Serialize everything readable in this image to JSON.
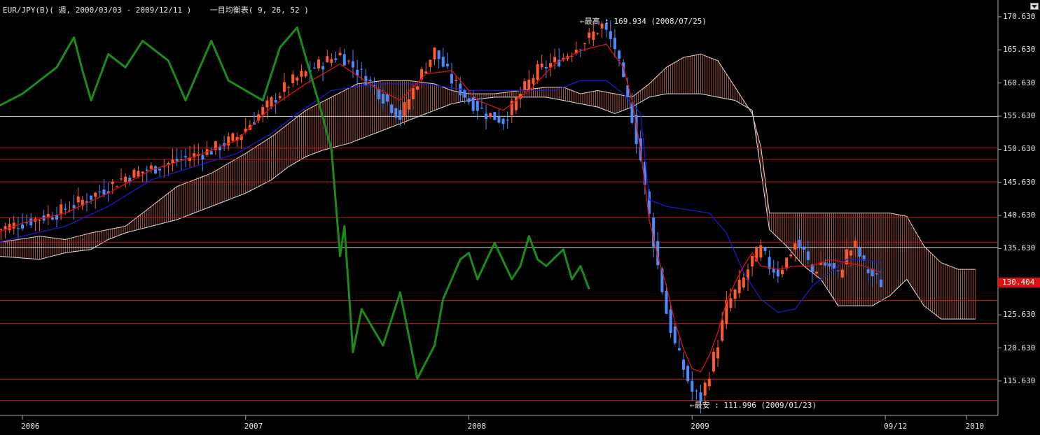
{
  "header": {
    "symbol": "EUR/JPY(B)",
    "period": "週",
    "range": "2000/03/03 - 2009/12/11",
    "indicator": "一目均衡表( 9, 26, 52 )",
    "full": "EUR/JPY(B)( 週, 2000/03/03 - 2009/12/11 )    一目均衡表( 9, 26, 52 )"
  },
  "annotations": {
    "high": "←最高 : 169.934 (2008/07/25)",
    "low": "←最安 : 111.996 (2009/01/23)"
  },
  "current_price": "130.404",
  "colors": {
    "background": "#000000",
    "bull_candle": "#ff5a2a",
    "bear_candle": "#4a8cff",
    "tenkan": "#e01010",
    "kijun": "#1a1ad0",
    "chikou": "#1a8c1a",
    "cloud_bull": "#e07050",
    "cloud_bear": "#7070e0",
    "hline_red": "#d01818",
    "hline_white": "#d8d8d8"
  },
  "chart_data": {
    "type": "candlestick-ichimoku",
    "y_axis": {
      "ticks": [
        "170.630",
        "165.630",
        "160.630",
        "155.630",
        "150.630",
        "145.630",
        "140.630",
        "135.630",
        "130.630",
        "125.630",
        "120.630",
        "115.630"
      ],
      "ylim": [
        111,
        171
      ]
    },
    "x_axis": {
      "ticks": [
        "2006",
        "2007",
        "2008",
        "2009",
        "09/12",
        "2010"
      ],
      "tick_weeks": [
        0,
        52,
        104,
        156,
        201,
        220
      ]
    },
    "horizontal_lines": [
      {
        "value": 155.6,
        "color": "white"
      },
      {
        "value": 150.8,
        "color": "red"
      },
      {
        "value": 149.1,
        "color": "red"
      },
      {
        "value": 145.7,
        "color": "red"
      },
      {
        "value": 140.3,
        "color": "red"
      },
      {
        "value": 136.6,
        "color": "red"
      },
      {
        "value": 135.8,
        "color": "white"
      },
      {
        "value": 127.8,
        "color": "red"
      },
      {
        "value": 124.3,
        "color": "red"
      },
      {
        "value": 115.9,
        "color": "red"
      },
      {
        "value": 112.7,
        "color": "red"
      }
    ],
    "close_keypoints": [
      [
        -6,
        138.5
      ],
      [
        0,
        139.5
      ],
      [
        8,
        141.0
      ],
      [
        16,
        143.5
      ],
      [
        24,
        146.5
      ],
      [
        34,
        148.5
      ],
      [
        44,
        150.5
      ],
      [
        50,
        152.5
      ],
      [
        56,
        156.5
      ],
      [
        62,
        160.5
      ],
      [
        68,
        163.0
      ],
      [
        74,
        165.0
      ],
      [
        82,
        160.0
      ],
      [
        88,
        155.5
      ],
      [
        92,
        161.0
      ],
      [
        96,
        165.5
      ],
      [
        100,
        161.0
      ],
      [
        104,
        158.0
      ],
      [
        108,
        156.0
      ],
      [
        112,
        155.0
      ],
      [
        116,
        159.0
      ],
      [
        120,
        162.5
      ],
      [
        126,
        164.5
      ],
      [
        132,
        167.5
      ],
      [
        135,
        169.3
      ],
      [
        138,
        166.0
      ],
      [
        140,
        160.5
      ],
      [
        142,
        155.5
      ],
      [
        144,
        149.0
      ],
      [
        146,
        140.5
      ],
      [
        148,
        133.0
      ],
      [
        150,
        126.0
      ],
      [
        152,
        121.0
      ],
      [
        154,
        117.5
      ],
      [
        156,
        114.0
      ],
      [
        158,
        113.0
      ],
      [
        160,
        117.0
      ],
      [
        162,
        121.5
      ],
      [
        164,
        127.0
      ],
      [
        166,
        129.0
      ],
      [
        168,
        131.0
      ],
      [
        170,
        134.0
      ],
      [
        172,
        135.5
      ],
      [
        174,
        133.0
      ],
      [
        176,
        132.0
      ],
      [
        178,
        134.0
      ],
      [
        180,
        136.5
      ],
      [
        182,
        135.0
      ],
      [
        184,
        132.0
      ],
      [
        186,
        133.5
      ],
      [
        188,
        133.0
      ],
      [
        190,
        131.5
      ],
      [
        192,
        135.0
      ],
      [
        194,
        136.0
      ],
      [
        196,
        133.0
      ],
      [
        198,
        131.5
      ],
      [
        200,
        130.4
      ]
    ],
    "chikou_keypoints": [
      [
        -32,
        142.0
      ],
      [
        -26,
        145.0
      ],
      [
        -18,
        148.5
      ],
      [
        -10,
        154.0
      ],
      [
        -6,
        157.0
      ],
      [
        0,
        159.0
      ],
      [
        4,
        161.0
      ],
      [
        8,
        163.0
      ],
      [
        12,
        167.5
      ],
      [
        14,
        162.5
      ],
      [
        16,
        158.0
      ],
      [
        20,
        165.0
      ],
      [
        24,
        163.0
      ],
      [
        28,
        167.0
      ],
      [
        34,
        164.0
      ],
      [
        38,
        158.0
      ],
      [
        44,
        167.0
      ],
      [
        48,
        161.0
      ],
      [
        56,
        158.0
      ],
      [
        60,
        166.0
      ],
      [
        64,
        169.0
      ],
      [
        68,
        160.0
      ],
      [
        70,
        155.5
      ],
      [
        72,
        150.5
      ],
      [
        74,
        134.5
      ],
      [
        75,
        139.0
      ],
      [
        77,
        120.0
      ],
      [
        79,
        126.5
      ],
      [
        84,
        121.0
      ],
      [
        88,
        129.0
      ],
      [
        92,
        116.0
      ],
      [
        96,
        121.0
      ],
      [
        98,
        128.0
      ],
      [
        102,
        134.0
      ],
      [
        104,
        135.0
      ],
      [
        106,
        131.0
      ],
      [
        110,
        136.5
      ],
      [
        114,
        131.0
      ],
      [
        116,
        133.0
      ],
      [
        118,
        137.5
      ],
      [
        120,
        134.0
      ],
      [
        122,
        133.0
      ],
      [
        126,
        135.5
      ],
      [
        128,
        131.0
      ],
      [
        130,
        133.0
      ],
      [
        132,
        129.5
      ]
    ],
    "tenkan_keypoints": [
      [
        -6,
        138.0
      ],
      [
        0,
        139.5
      ],
      [
        10,
        141.0
      ],
      [
        20,
        144.0
      ],
      [
        30,
        147.5
      ],
      [
        40,
        149.5
      ],
      [
        50,
        152.0
      ],
      [
        58,
        157.0
      ],
      [
        66,
        160.5
      ],
      [
        74,
        163.5
      ],
      [
        82,
        160.0
      ],
      [
        88,
        158.0
      ],
      [
        94,
        162.0
      ],
      [
        100,
        162.5
      ],
      [
        106,
        158.0
      ],
      [
        112,
        156.5
      ],
      [
        118,
        159.5
      ],
      [
        124,
        163.5
      ],
      [
        130,
        165.5
      ],
      [
        136,
        166.5
      ],
      [
        140,
        163.0
      ],
      [
        142,
        158.0
      ],
      [
        144,
        150.5
      ],
      [
        146,
        140.0
      ],
      [
        148,
        134.5
      ],
      [
        150,
        130.0
      ],
      [
        152,
        124.5
      ],
      [
        154,
        120.5
      ],
      [
        156,
        117.5
      ],
      [
        158,
        117.0
      ],
      [
        160,
        119.5
      ],
      [
        162,
        123.0
      ],
      [
        164,
        127.5
      ],
      [
        166,
        130.5
      ],
      [
        168,
        133.0
      ],
      [
        170,
        135.0
      ],
      [
        172,
        133.0
      ],
      [
        176,
        132.5
      ],
      [
        180,
        133.0
      ],
      [
        184,
        133.0
      ],
      [
        188,
        134.0
      ],
      [
        192,
        133.5
      ],
      [
        196,
        133.0
      ],
      [
        200,
        132.0
      ]
    ],
    "kijun_keypoints": [
      [
        -6,
        136.5
      ],
      [
        0,
        137.5
      ],
      [
        10,
        139.0
      ],
      [
        20,
        142.0
      ],
      [
        30,
        146.0
      ],
      [
        40,
        148.0
      ],
      [
        50,
        150.0
      ],
      [
        58,
        153.0
      ],
      [
        64,
        156.0
      ],
      [
        72,
        159.5
      ],
      [
        82,
        160.5
      ],
      [
        94,
        160.5
      ],
      [
        104,
        159.5
      ],
      [
        114,
        159.5
      ],
      [
        124,
        159.5
      ],
      [
        130,
        161.0
      ],
      [
        136,
        161.0
      ],
      [
        140,
        159.0
      ],
      [
        144,
        156.0
      ],
      [
        146,
        143.0
      ],
      [
        150,
        142.0
      ],
      [
        160,
        141.0
      ],
      [
        164,
        138.0
      ],
      [
        168,
        132.0
      ],
      [
        172,
        128.0
      ],
      [
        176,
        126.0
      ],
      [
        180,
        126.5
      ],
      [
        184,
        130.0
      ],
      [
        188,
        132.0
      ],
      [
        192,
        134.0
      ],
      [
        196,
        134.0
      ],
      [
        200,
        133.5
      ]
    ],
    "spanA_keypoints": [
      [
        -6,
        136.5
      ],
      [
        4,
        137.5
      ],
      [
        10,
        137.0
      ],
      [
        16,
        138.0
      ],
      [
        24,
        139.0
      ],
      [
        30,
        142.0
      ],
      [
        36,
        145.0
      ],
      [
        44,
        147.0
      ],
      [
        52,
        150.0
      ],
      [
        58,
        152.5
      ],
      [
        62,
        154.5
      ],
      [
        66,
        156.5
      ],
      [
        72,
        158.5
      ],
      [
        78,
        160.5
      ],
      [
        84,
        161.0
      ],
      [
        90,
        161.0
      ],
      [
        96,
        160.5
      ],
      [
        100,
        159.5
      ],
      [
        104,
        159.0
      ],
      [
        110,
        159.0
      ],
      [
        116,
        159.5
      ],
      [
        122,
        160.0
      ],
      [
        126,
        160.0
      ],
      [
        130,
        159.0
      ],
      [
        134,
        159.5
      ],
      [
        138,
        159.0
      ],
      [
        142,
        158.5
      ],
      [
        146,
        160.5
      ],
      [
        150,
        163.0
      ],
      [
        154,
        164.5
      ],
      [
        158,
        165.0
      ],
      [
        162,
        164.0
      ],
      [
        166,
        160.0
      ],
      [
        170,
        156.0
      ],
      [
        172,
        151.0
      ],
      [
        174,
        141.0
      ],
      [
        180,
        141.0
      ],
      [
        186,
        141.0
      ],
      [
        190,
        141.0
      ],
      [
        196,
        141.0
      ],
      [
        202,
        141.0
      ],
      [
        206,
        140.5
      ],
      [
        210,
        136.0
      ],
      [
        214,
        133.5
      ],
      [
        218,
        132.5
      ],
      [
        222,
        132.5
      ]
    ],
    "spanB_keypoints": [
      [
        -6,
        134.5
      ],
      [
        4,
        134.0
      ],
      [
        10,
        135.0
      ],
      [
        16,
        135.5
      ],
      [
        20,
        137.0
      ],
      [
        24,
        138.0
      ],
      [
        30,
        139.0
      ],
      [
        36,
        140.0
      ],
      [
        40,
        141.0
      ],
      [
        46,
        142.5
      ],
      [
        52,
        144.0
      ],
      [
        58,
        146.0
      ],
      [
        62,
        148.0
      ],
      [
        66,
        149.5
      ],
      [
        70,
        150.5
      ],
      [
        76,
        151.5
      ],
      [
        80,
        152.5
      ],
      [
        86,
        154.0
      ],
      [
        90,
        155.0
      ],
      [
        96,
        156.5
      ],
      [
        100,
        157.5
      ],
      [
        104,
        158.0
      ],
      [
        110,
        158.5
      ],
      [
        116,
        158.5
      ],
      [
        122,
        158.5
      ],
      [
        126,
        158.0
      ],
      [
        130,
        157.5
      ],
      [
        134,
        157.0
      ],
      [
        138,
        156.0
      ],
      [
        142,
        157.0
      ],
      [
        146,
        158.5
      ],
      [
        150,
        159.0
      ],
      [
        154,
        159.0
      ],
      [
        158,
        159.0
      ],
      [
        162,
        158.5
      ],
      [
        166,
        158.0
      ],
      [
        170,
        156.5
      ],
      [
        174,
        138.5
      ],
      [
        178,
        136.0
      ],
      [
        182,
        133.0
      ],
      [
        186,
        131.0
      ],
      [
        190,
        127.0
      ],
      [
        194,
        127.0
      ],
      [
        198,
        127.0
      ],
      [
        202,
        128.5
      ],
      [
        206,
        131.0
      ],
      [
        210,
        127.0
      ],
      [
        214,
        125.0
      ],
      [
        218,
        125.0
      ],
      [
        222,
        125.0
      ]
    ],
    "title": "",
    "xlabel": "",
    "ylabel": ""
  }
}
